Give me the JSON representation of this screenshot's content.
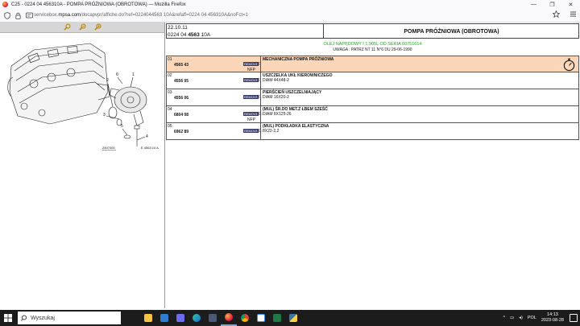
{
  "window": {
    "title": "C25 - 0224 04 456310A - POMPA PRÓŻNIOWA (OBROTOWA) — Mozilla Firefox",
    "minimize": "—",
    "maximize": "❐",
    "close": "✕"
  },
  "browser": {
    "url_prefix": "servicebox.",
    "url_host": "mpsa.com",
    "url_path": "/docapvpr/affiche.do?ref=0224044563 10A&refaff=0224 04 456310A&noFct=1"
  },
  "left_toolbar": {
    "tools": [
      "search-icon",
      "zoom-out-icon",
      "zoom-in-icon"
    ]
  },
  "diagram": {
    "callouts": [
      "1",
      "2",
      "3",
      "4",
      "5",
      "6"
    ],
    "code_left": "2507005",
    "code_right": "E 4563 10 A"
  },
  "header": {
    "date": "22.10.11",
    "ref_prefix": "0224 04 ",
    "ref_bold": "4563",
    "ref_suffix": " 10A",
    "title": "POMPA PRÓŻNIOWA (OBROTOWA)"
  },
  "notes": {
    "line1": "OLEJ NAPĘDOWY I 1.905L OD SERIA 00751614",
    "line2": "UWAGA : PATRZ NT 11 N°6 DU 29-06-1990"
  },
  "parts": [
    {
      "idx": "01",
      "ref": "4565 43",
      "badge": "REMOVE",
      "qty": "01",
      "nfp": "NFP",
      "name": "MECHANICZNA POMPA PRÓŻNIOWA",
      "dim": "",
      "selected": true
    },
    {
      "idx": "02",
      "ref": "4556 05",
      "badge": "REMOVE",
      "qty": "01",
      "nfp": "",
      "name": "USZCZELKA UKŁ KIEROWNICZEGO",
      "dim": "DIAM 44X48-2",
      "selected": false
    },
    {
      "idx": "03",
      "ref": "4556 06",
      "badge": "REMOVE",
      "qty": "01",
      "nfp": "",
      "name": "PIERŚCIEŃ USZCZELNIAJĄCY",
      "dim": "DIAM 16X20-2",
      "selected": false
    },
    {
      "idx": "04",
      "ref": "6804 08",
      "badge": "REMOVE",
      "qty": "03",
      "nfp": "NFP",
      "name": "(MUL) ŚR.DO MET.Z ŁBEM SZEŚĆ",
      "dim": "DIAM 8X125-26",
      "selected": false
    },
    {
      "idx": "05",
      "ref": "6962 89",
      "badge": "REMOVE",
      "qty": "03",
      "nfp": "",
      "name": "(MUL) PODKŁADKA ELASTYCZNA",
      "dim": "8X22-2,2",
      "selected": false
    }
  ],
  "taskbar": {
    "search_placeholder": "Wyszukaj",
    "apps": [
      "file-explorer",
      "mail",
      "store",
      "edge",
      "calculator",
      "firefox",
      "chrome",
      "ms-paint",
      "excel",
      "python"
    ],
    "language": "POL",
    "time": "14:13",
    "date": "2023-08-28"
  }
}
